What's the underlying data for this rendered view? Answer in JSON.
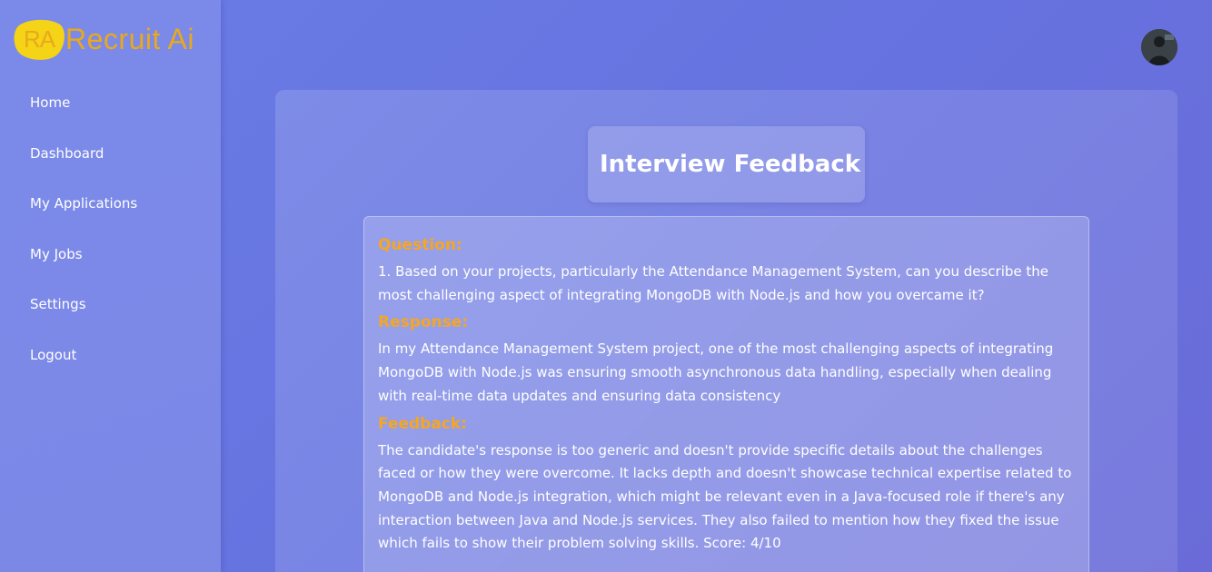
{
  "brand": {
    "badge": "RA",
    "name": "Recruit Ai",
    "color": "#e8a91c",
    "badge_bg": "#f5d316"
  },
  "sidebar": {
    "items": [
      {
        "label": "Home"
      },
      {
        "label": "Dashboard"
      },
      {
        "label": "My Applications"
      },
      {
        "label": "My Jobs"
      },
      {
        "label": "Settings"
      },
      {
        "label": "Logout"
      }
    ]
  },
  "header": {
    "avatar_icon": "user-avatar"
  },
  "main": {
    "title": "Interview Feedback",
    "feedback": {
      "question_label": "Question:",
      "question_text": "1. Based on your projects, particularly the Attendance Management System, can you describe the most challenging aspect of integrating MongoDB with Node.js and how you overcame it?",
      "response_label": "Response:",
      "response_text": "In my Attendance Management System project, one of the most challenging aspects of integrating MongoDB with Node.js was ensuring smooth asynchronous data handling, especially when dealing with real-time data updates and ensuring data consistency",
      "feedback_label": "Feedback:",
      "feedback_text": "The candidate's response is too generic and doesn't provide specific details about the challenges faced or how they were overcome. It lacks depth and doesn't showcase technical expertise related to MongoDB and Node.js integration, which might be relevant even in a Java-focused role if there's any interaction between Java and Node.js services. They also failed to mention how they fixed the issue which fails to show their problem solving skills. Score: 4/10"
    }
  },
  "colors": {
    "accent": "#f5a623",
    "background": "#6673e0",
    "sidebar": "#7b8ae9"
  }
}
